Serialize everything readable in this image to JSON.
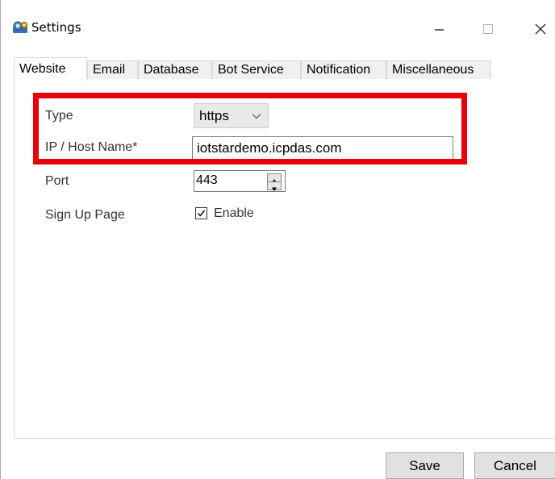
{
  "window": {
    "title": "Settings",
    "app_icon": "settings-app-icon",
    "controls": {
      "minimize": "minimize-icon",
      "maximize": "maximize-icon",
      "close": "close-icon"
    }
  },
  "tabs": [
    {
      "label": "Website",
      "active": true
    },
    {
      "label": "Email"
    },
    {
      "label": "Database"
    },
    {
      "label": "Bot Service"
    },
    {
      "label": "Notification"
    },
    {
      "label": "Miscellaneous"
    }
  ],
  "form": {
    "type": {
      "label": "Type",
      "value": "https"
    },
    "host": {
      "label": "IP / Host Name*",
      "value": "iotstardemo.icpdas.com"
    },
    "port": {
      "label": "Port",
      "value": "443"
    },
    "signup": {
      "label": "Sign Up Page",
      "checkbox_label": "Enable",
      "checked": true
    }
  },
  "buttons": {
    "save": "Save",
    "cancel": "Cancel"
  },
  "colors": {
    "highlight": "#e8000b",
    "tab_inactive": "#f0f0f0",
    "button_face": "#e1e1e1"
  }
}
